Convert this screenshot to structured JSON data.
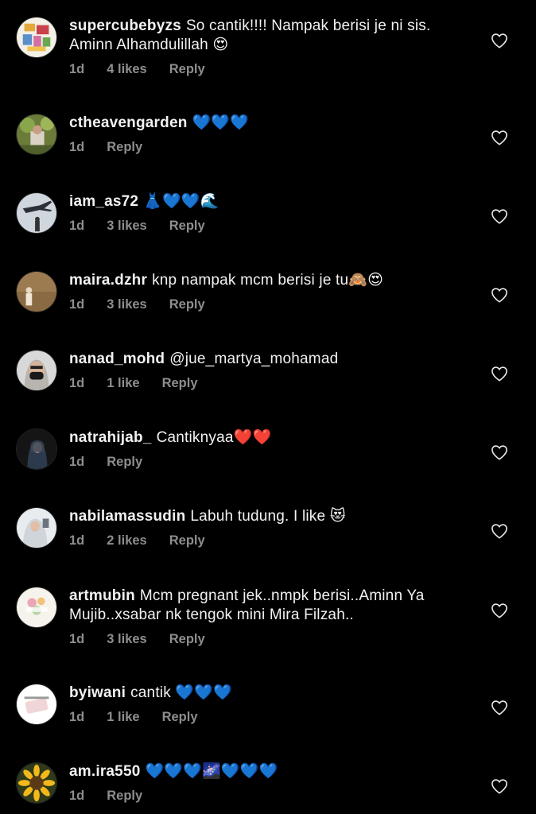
{
  "comments": [
    {
      "username": "supercubebyzs",
      "text": "So cantik!!!! Nampak berisi je ni sis. Aminn Alhamdulillah 😍",
      "time": "1d",
      "likes": "4 likes",
      "reply": "Reply",
      "avatar": "product-collage-avatar"
    },
    {
      "username": "ctheavengarden",
      "text": "💙💙💙",
      "time": "1d",
      "likes": "",
      "reply": "Reply",
      "avatar": "garden-avatar"
    },
    {
      "username": "iam_as72",
      "text": "👗💙💙🌊",
      "time": "1d",
      "likes": "3 likes",
      "reply": "Reply",
      "avatar": "airplane-avatar"
    },
    {
      "username": "maira.dzhr",
      "text": "knp nampak mcm berisi je tu🙈😍",
      "time": "1d",
      "likes": "3 likes",
      "reply": "Reply",
      "avatar": "person-brown-avatar"
    },
    {
      "username": "nanad_mohd",
      "text": "@jue_martya_mohamad",
      "time": "1d",
      "likes": "1 like",
      "reply": "Reply",
      "avatar": "masked-person-avatar"
    },
    {
      "username": "natrahijab_",
      "text": "Cantiknyaa❤️❤️",
      "time": "1d",
      "likes": "",
      "reply": "Reply",
      "avatar": "hijab-dark-avatar"
    },
    {
      "username": "nabilamassudin",
      "text": "Labuh tudung. I like 😻",
      "time": "1d",
      "likes": "2 likes",
      "reply": "Reply",
      "avatar": "hijab-light-avatar"
    },
    {
      "username": "artmubin",
      "text": "Mcm pregnant jek..nmpk berisi..Aminn Ya Mujib..xsabar nk tengok mini Mira Filzah..",
      "time": "1d",
      "likes": "3 likes",
      "reply": "Reply",
      "avatar": "floral-logo-avatar"
    },
    {
      "username": "byiwani",
      "text": "cantik 💙💙💙",
      "time": "1d",
      "likes": "1 like",
      "reply": "Reply",
      "avatar": "brand-logo-avatar"
    },
    {
      "username": "am.ira550",
      "text": "💙💙💙🌌💙💙💙",
      "time": "1d",
      "likes": "",
      "reply": "Reply",
      "avatar": "sunflower-avatar"
    }
  ]
}
